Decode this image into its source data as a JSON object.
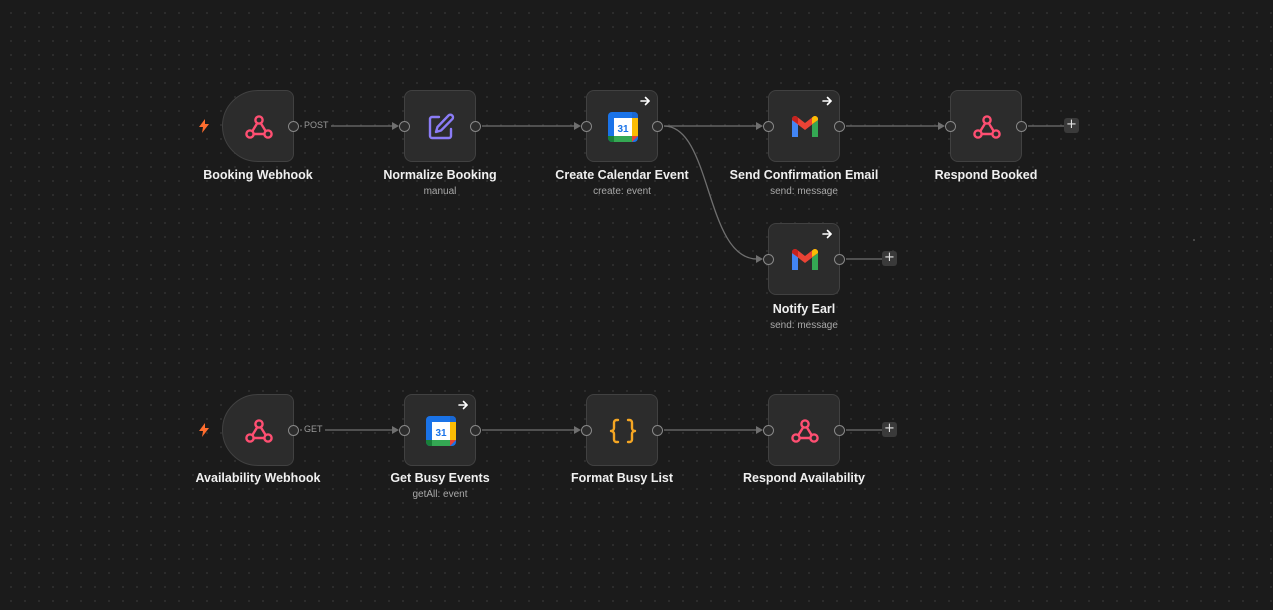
{
  "colors": {
    "background": "#1b1b1b",
    "node": "#2c2c2c",
    "trigger_bolt": "#ff6d2e",
    "webhook_icon": "#ff4f72",
    "edit_icon": "#8b7cf6",
    "code_icon": "#f5a623"
  },
  "workflow": {
    "nodes": [
      {
        "id": "booking-webhook",
        "title": "Booking Webhook",
        "subtitle": "",
        "icon": "webhook-icon",
        "trigger": true
      },
      {
        "id": "normalize-booking",
        "title": "Normalize Booking",
        "subtitle": "manual",
        "icon": "edit-icon"
      },
      {
        "id": "create-calendar-event",
        "title": "Create Calendar Event",
        "subtitle": "create: event",
        "icon": "google-calendar-icon",
        "badge": true
      },
      {
        "id": "send-confirmation-email",
        "title": "Send Confirmation Email",
        "subtitle": "send: message",
        "icon": "gmail-icon",
        "badge": true
      },
      {
        "id": "respond-booked",
        "title": "Respond Booked",
        "subtitle": "",
        "icon": "webhook-icon"
      },
      {
        "id": "notify-earl",
        "title": "Notify Earl",
        "subtitle": "send: message",
        "icon": "gmail-icon",
        "badge": true
      },
      {
        "id": "availability-webhook",
        "title": "Availability Webhook",
        "subtitle": "",
        "icon": "webhook-icon",
        "trigger": true
      },
      {
        "id": "get-busy-events",
        "title": "Get Busy Events",
        "subtitle": "getAll: event",
        "icon": "google-calendar-icon",
        "badge": true
      },
      {
        "id": "format-busy-list",
        "title": "Format Busy List",
        "subtitle": "",
        "icon": "code-icon"
      },
      {
        "id": "respond-availability",
        "title": "Respond Availability",
        "subtitle": "",
        "icon": "webhook-icon"
      }
    ],
    "edge_labels": {
      "booking": "POST",
      "availability": "GET"
    },
    "calendar_day": "31",
    "add_label": "+"
  }
}
